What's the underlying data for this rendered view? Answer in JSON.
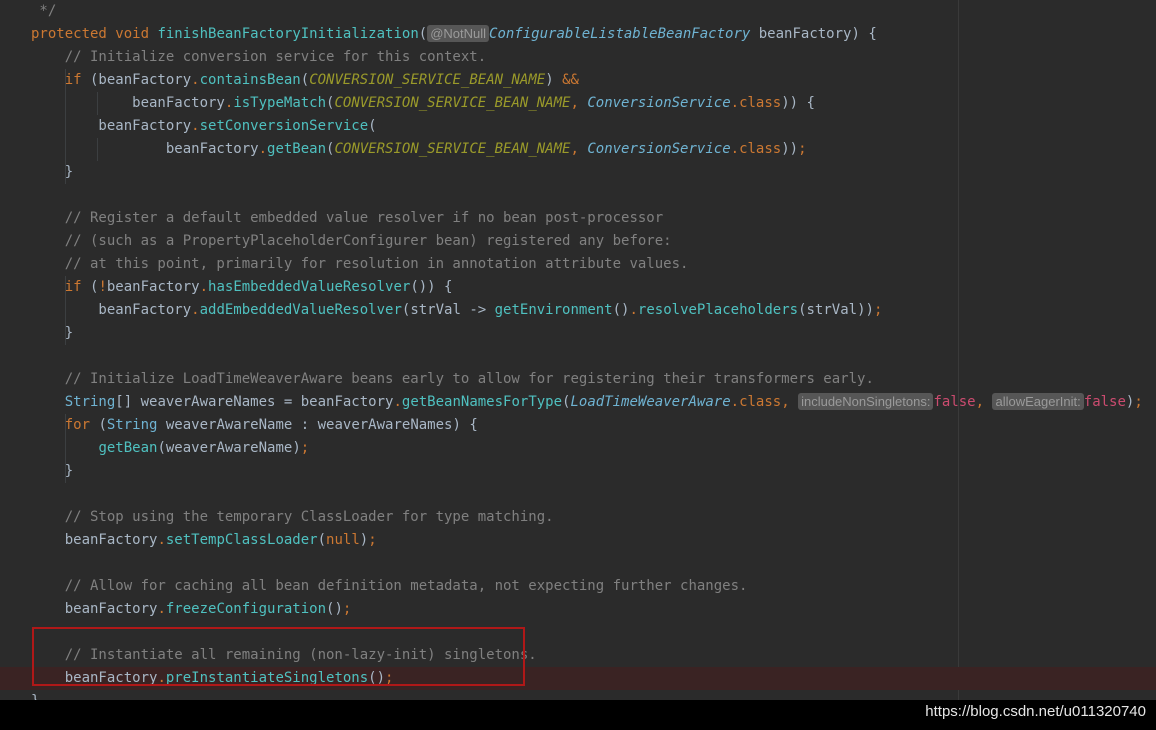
{
  "code": {
    "lines": [
      {
        "id": "l0",
        "tokens": [
          {
            "t": " */",
            "c": "cm"
          }
        ]
      },
      {
        "id": "l1",
        "tokens": [
          {
            "t": "protected ",
            "c": "kw"
          },
          {
            "t": "void ",
            "c": "kw"
          },
          {
            "t": "finishBeanFactoryInitialization",
            "c": "mth"
          },
          {
            "t": "(",
            "c": ""
          },
          {
            "t": "@NotNull",
            "c": "hint"
          },
          {
            "t": "ConfigurableListableBeanFactory",
            "c": "typ"
          },
          {
            "t": " beanFactory) {",
            "c": ""
          }
        ]
      },
      {
        "id": "l2",
        "tokens": [
          {
            "t": "    // Initialize conversion service for this context.",
            "c": "cm"
          }
        ]
      },
      {
        "id": "l3",
        "tokens": [
          {
            "t": "    ",
            "c": ""
          },
          {
            "t": "if",
            "c": "kw"
          },
          {
            "t": " (beanFactory",
            "c": ""
          },
          {
            "t": ".",
            "c": "pn"
          },
          {
            "t": "containsBean",
            "c": "mth"
          },
          {
            "t": "(",
            "c": ""
          },
          {
            "t": "CONVERSION_SERVICE_BEAN_NAME",
            "c": "cst"
          },
          {
            "t": ") ",
            "c": ""
          },
          {
            "t": "&&",
            "c": "kw"
          }
        ]
      },
      {
        "id": "l4",
        "tokens": [
          {
            "t": "            beanFactory",
            "c": ""
          },
          {
            "t": ".",
            "c": "pn"
          },
          {
            "t": "isTypeMatch",
            "c": "mth"
          },
          {
            "t": "(",
            "c": ""
          },
          {
            "t": "CONVERSION_SERVICE_BEAN_NAME",
            "c": "cst"
          },
          {
            "t": ", ",
            "c": "pn"
          },
          {
            "t": "ConversionService",
            "c": "typ"
          },
          {
            "t": ".",
            "c": "pn"
          },
          {
            "t": "class",
            "c": "kw"
          },
          {
            "t": ")) {",
            "c": ""
          }
        ]
      },
      {
        "id": "l5",
        "tokens": [
          {
            "t": "        beanFactory",
            "c": ""
          },
          {
            "t": ".",
            "c": "pn"
          },
          {
            "t": "setConversionService",
            "c": "mth"
          },
          {
            "t": "(",
            "c": ""
          }
        ]
      },
      {
        "id": "l6",
        "tokens": [
          {
            "t": "                beanFactory",
            "c": ""
          },
          {
            "t": ".",
            "c": "pn"
          },
          {
            "t": "getBean",
            "c": "mth"
          },
          {
            "t": "(",
            "c": ""
          },
          {
            "t": "CONVERSION_SERVICE_BEAN_NAME",
            "c": "cst"
          },
          {
            "t": ", ",
            "c": "pn"
          },
          {
            "t": "ConversionService",
            "c": "typ"
          },
          {
            "t": ".",
            "c": "pn"
          },
          {
            "t": "class",
            "c": "kw"
          },
          {
            "t": "))",
            "c": ""
          },
          {
            "t": ";",
            "c": "pn"
          }
        ]
      },
      {
        "id": "l7",
        "tokens": [
          {
            "t": "    }",
            "c": ""
          }
        ]
      },
      {
        "id": "l8",
        "tokens": []
      },
      {
        "id": "l9",
        "tokens": [
          {
            "t": "    // Register a default embedded value resolver if no bean post-processor",
            "c": "cm"
          }
        ]
      },
      {
        "id": "l10",
        "tokens": [
          {
            "t": "    // (such as a PropertyPlaceholderConfigurer bean) registered any before:",
            "c": "cm"
          }
        ]
      },
      {
        "id": "l11",
        "tokens": [
          {
            "t": "    // at this point, primarily for resolution in annotation attribute values.",
            "c": "cm"
          }
        ]
      },
      {
        "id": "l12",
        "tokens": [
          {
            "t": "    ",
            "c": ""
          },
          {
            "t": "if",
            "c": "kw"
          },
          {
            "t": " (",
            "c": ""
          },
          {
            "t": "!",
            "c": "kw"
          },
          {
            "t": "beanFactory",
            "c": ""
          },
          {
            "t": ".",
            "c": "pn"
          },
          {
            "t": "hasEmbeddedValueResolver",
            "c": "mth"
          },
          {
            "t": "()) {",
            "c": ""
          }
        ]
      },
      {
        "id": "l13",
        "tokens": [
          {
            "t": "        beanFactory",
            "c": ""
          },
          {
            "t": ".",
            "c": "pn"
          },
          {
            "t": "addEmbeddedValueResolver",
            "c": "mth"
          },
          {
            "t": "(strVal -> ",
            "c": ""
          },
          {
            "t": "getEnvironment",
            "c": "mth"
          },
          {
            "t": "()",
            "c": ""
          },
          {
            "t": ".",
            "c": "pn"
          },
          {
            "t": "resolvePlaceholders",
            "c": "mth"
          },
          {
            "t": "(strVal))",
            "c": ""
          },
          {
            "t": ";",
            "c": "pn"
          }
        ]
      },
      {
        "id": "l14",
        "tokens": [
          {
            "t": "    }",
            "c": ""
          }
        ]
      },
      {
        "id": "l15",
        "tokens": []
      },
      {
        "id": "l16",
        "tokens": [
          {
            "t": "    // Initialize LoadTimeWeaverAware beans early to allow for registering their transformers early.",
            "c": "cm"
          }
        ]
      },
      {
        "id": "l17",
        "tokens": [
          {
            "t": "    ",
            "c": ""
          },
          {
            "t": "String",
            "c": "typn"
          },
          {
            "t": "[] weaverAwareNames = beanFactory",
            "c": ""
          },
          {
            "t": ".",
            "c": "pn"
          },
          {
            "t": "getBeanNamesForType",
            "c": "mth"
          },
          {
            "t": "(",
            "c": ""
          },
          {
            "t": "LoadTimeWeaverAware",
            "c": "typ"
          },
          {
            "t": ".",
            "c": "pn"
          },
          {
            "t": "class",
            "c": "kw"
          },
          {
            "t": ", ",
            "c": "pn"
          },
          {
            "t": "includeNonSingletons:",
            "c": "hint"
          },
          {
            "t": "false",
            "c": "kwp"
          },
          {
            "t": ", ",
            "c": "pn"
          },
          {
            "t": "allowEagerInit:",
            "c": "hint"
          },
          {
            "t": "false",
            "c": "kwp"
          },
          {
            "t": ")",
            "c": ""
          },
          {
            "t": ";",
            "c": "pn"
          }
        ]
      },
      {
        "id": "l18",
        "tokens": [
          {
            "t": "    ",
            "c": ""
          },
          {
            "t": "for",
            "c": "kw"
          },
          {
            "t": " (",
            "c": ""
          },
          {
            "t": "String",
            "c": "typn"
          },
          {
            "t": " weaverAwareName : weaverAwareNames) {",
            "c": ""
          }
        ]
      },
      {
        "id": "l19",
        "tokens": [
          {
            "t": "        ",
            "c": ""
          },
          {
            "t": "getBean",
            "c": "mth"
          },
          {
            "t": "(weaverAwareName)",
            "c": ""
          },
          {
            "t": ";",
            "c": "pn"
          }
        ]
      },
      {
        "id": "l20",
        "tokens": [
          {
            "t": "    }",
            "c": ""
          }
        ]
      },
      {
        "id": "l21",
        "tokens": []
      },
      {
        "id": "l22",
        "tokens": [
          {
            "t": "    // Stop using the temporary ClassLoader for type matching.",
            "c": "cm"
          }
        ]
      },
      {
        "id": "l23",
        "tokens": [
          {
            "t": "    beanFactory",
            "c": ""
          },
          {
            "t": ".",
            "c": "pn"
          },
          {
            "t": "setTempClassLoader",
            "c": "mth"
          },
          {
            "t": "(",
            "c": ""
          },
          {
            "t": "null",
            "c": "kw"
          },
          {
            "t": ")",
            "c": ""
          },
          {
            "t": ";",
            "c": "pn"
          }
        ]
      },
      {
        "id": "l24",
        "tokens": []
      },
      {
        "id": "l25",
        "tokens": [
          {
            "t": "    // Allow for caching all bean definition metadata, not expecting further changes.",
            "c": "cm"
          }
        ]
      },
      {
        "id": "l26",
        "tokens": [
          {
            "t": "    beanFactory",
            "c": ""
          },
          {
            "t": ".",
            "c": "pn"
          },
          {
            "t": "freezeConfiguration",
            "c": "mth"
          },
          {
            "t": "()",
            "c": ""
          },
          {
            "t": ";",
            "c": "pn"
          }
        ]
      },
      {
        "id": "l27",
        "tokens": []
      },
      {
        "id": "l28",
        "tokens": [
          {
            "t": "    // Instantiate all remaining (non-lazy-init) singletons.",
            "c": "cm"
          }
        ]
      },
      {
        "id": "l29",
        "highlight": true,
        "tokens": [
          {
            "t": "    beanFactory",
            "c": ""
          },
          {
            "t": ".",
            "c": "pn"
          },
          {
            "t": "preInstantiateSingletons",
            "c": "mth"
          },
          {
            "t": "()",
            "c": ""
          },
          {
            "t": ";",
            "c": "pn"
          }
        ]
      },
      {
        "id": "l30",
        "tokens": [
          {
            "t": "}",
            "c": ""
          }
        ]
      }
    ]
  },
  "annotation": {
    "color": "#b01818"
  },
  "watermark": {
    "text": "https://blog.csdn.net/u011320740"
  },
  "colors": {
    "background": "#2b2b2b",
    "comment": "#808080",
    "keyword": "#cc7832",
    "method": "#4fc1c0",
    "constant": "#9a9a2a",
    "type": "#6fb3d2",
    "highlight_line": "#3a2323"
  }
}
